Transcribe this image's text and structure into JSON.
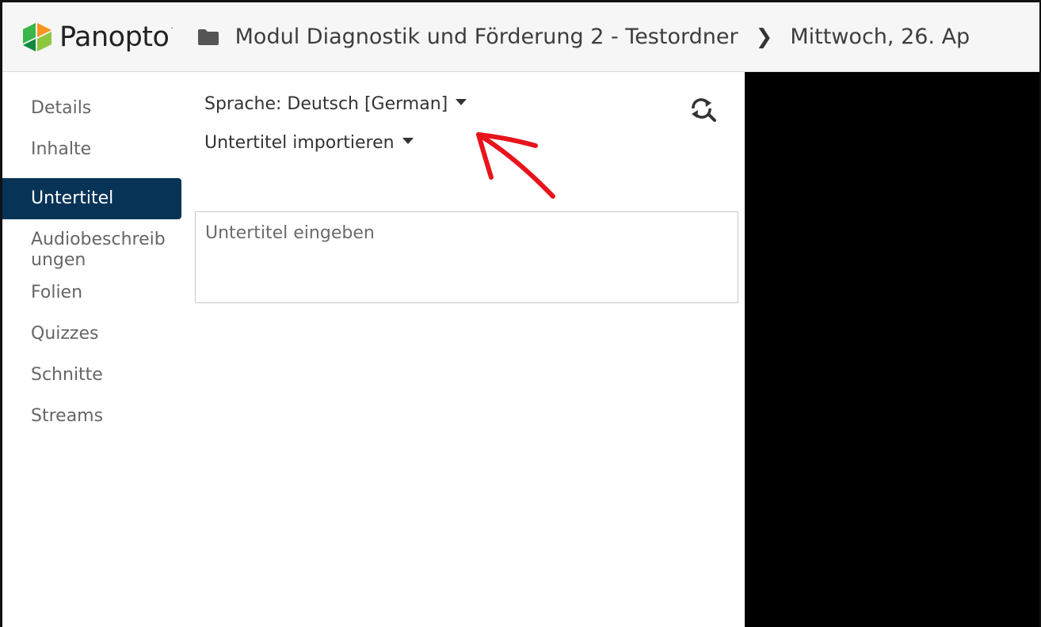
{
  "header": {
    "logo_text": "Panopto",
    "logo_tm": "·",
    "breadcrumb": [
      "Modul Diagnostik und Förderung 2 - Testordner",
      "Mittwoch, 26. Ap"
    ],
    "icons": {
      "folder": "folder-icon",
      "separator": "chevron-right-icon",
      "logo": "panopto-logo-icon"
    }
  },
  "sidebar": {
    "items": [
      {
        "label": "Details"
      },
      {
        "label": "Inhalte"
      },
      {
        "label": "Untertitel",
        "active": true
      },
      {
        "label": "Audiobeschreib ungen"
      },
      {
        "label": "Folien"
      },
      {
        "label": "Quizzes"
      },
      {
        "label": "Schnitte"
      },
      {
        "label": "Streams"
      }
    ]
  },
  "captions": {
    "language_label": "Sprache: Deutsch [German]",
    "import_label": "Untertitel importieren",
    "input_placeholder": "Untertitel eingeben",
    "refresh_icon": "search-refresh-icon"
  },
  "colors": {
    "active_nav": "#073356",
    "annotation_arrow": "#e8141c",
    "video_background": "#000000"
  }
}
